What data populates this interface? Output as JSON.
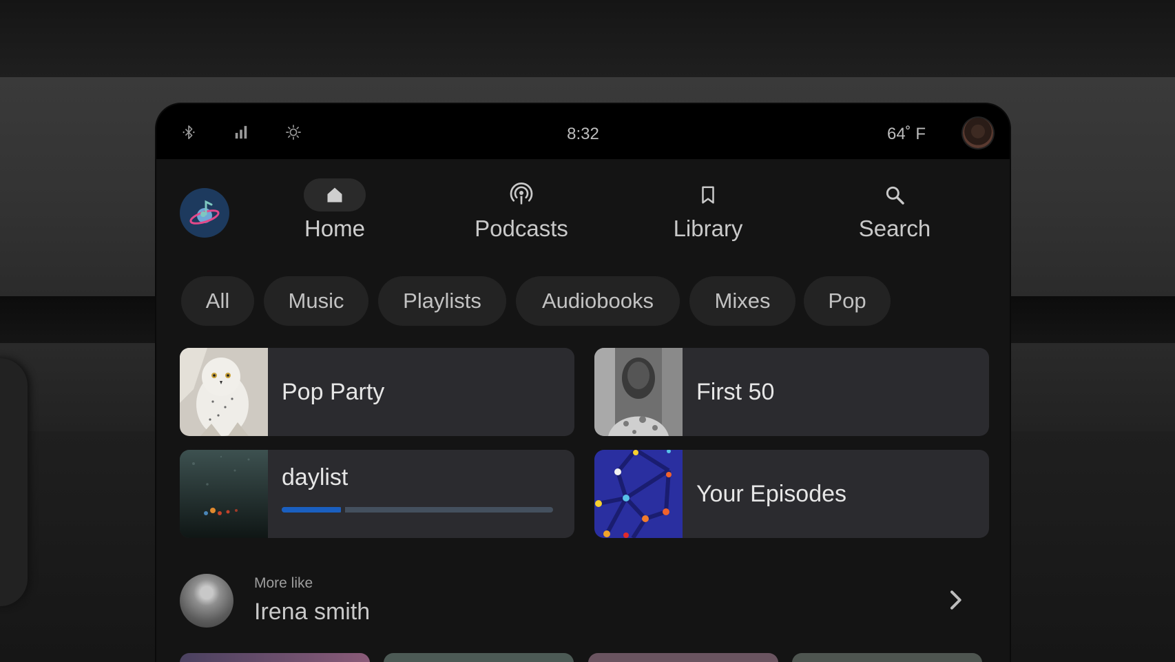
{
  "status_bar": {
    "time": "8:32",
    "temperature": "64˚ F",
    "icons": [
      "bluetooth-icon",
      "signal-icon",
      "brightness-icon"
    ]
  },
  "nav": {
    "items": [
      {
        "label": "Home",
        "icon": "home-icon",
        "active": true
      },
      {
        "label": "Podcasts",
        "icon": "podcast-icon",
        "active": false
      },
      {
        "label": "Library",
        "icon": "bookmark-icon",
        "active": false
      },
      {
        "label": "Search",
        "icon": "search-icon",
        "active": false
      }
    ]
  },
  "filters": [
    "All",
    "Music",
    "Playlists",
    "Audiobooks",
    "Mixes",
    "Pop"
  ],
  "cards": [
    {
      "title": "Pop Party"
    },
    {
      "title": "First 50"
    },
    {
      "title": "daylist",
      "progress": 0.22
    },
    {
      "title": "Your Episodes"
    }
  ],
  "more_like": {
    "prefix": "More like",
    "artist": "Irena smith"
  },
  "colors": {
    "accent": "#1a5fc0",
    "logo_bg": "#1d3a5e",
    "card_bg": "#2b2b2f"
  }
}
